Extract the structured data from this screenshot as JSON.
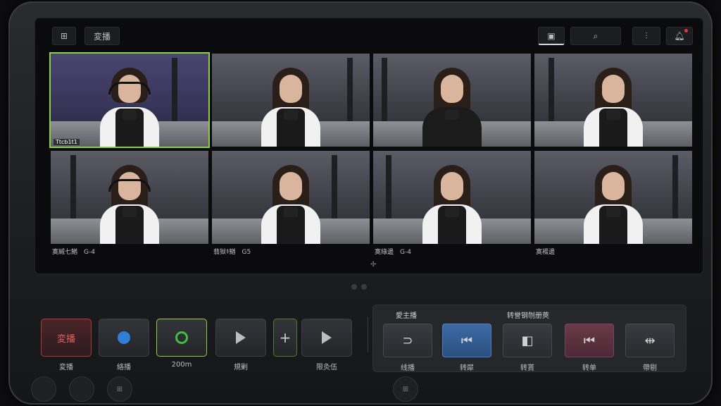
{
  "topbar": {
    "layout_icon": "layout-icon",
    "mode_label": "変播",
    "buttons": [
      {
        "icon": "screen-icon"
      },
      {
        "icon": "search-icon"
      },
      {
        "icon": "mixer-icon"
      },
      {
        "icon": "bell-icon"
      }
    ]
  },
  "tiles": [
    {
      "tag": "Ttcb1t1",
      "caption": ""
    },
    {
      "tag": "",
      "caption": ""
    },
    {
      "tag": "",
      "caption": ""
    },
    {
      "tag": "",
      "caption": ""
    },
    {
      "tag": "",
      "caption": "寞緘七鰌　G-4"
    },
    {
      "tag": "",
      "caption": "翡獄ｷ鰌　G5"
    },
    {
      "tag": "",
      "caption": "寞綠邊　G-4"
    },
    {
      "tag": "",
      "caption": "寞裰邊"
    }
  ],
  "controls": [
    {
      "label": "変播",
      "text": "変播"
    },
    {
      "label": "絡播",
      "text": ""
    },
    {
      "label": "200m",
      "text": ""
    },
    {
      "label": "規剿",
      "text": ""
    },
    {
      "label": "",
      "text": "+"
    },
    {
      "label": "限灸伍",
      "text": ""
    }
  ],
  "panel": {
    "title_left": "愛主播",
    "title_right": "转誉钢刎册莢",
    "buttons": [
      {
        "label": "线播",
        "icon": "⊃"
      },
      {
        "label": "转犀",
        "icon": "⏮"
      },
      {
        "label": "转貰",
        "icon": "◧"
      },
      {
        "label": "转单",
        "icon": "⏮"
      },
      {
        "label": "帶剔",
        "icon": "⇹"
      }
    ]
  },
  "colors": {
    "selected_border": "#8ad33e",
    "record_red": "#b13737",
    "accent_blue": "#2f7ed8",
    "accent_green": "#3fbf3f"
  }
}
